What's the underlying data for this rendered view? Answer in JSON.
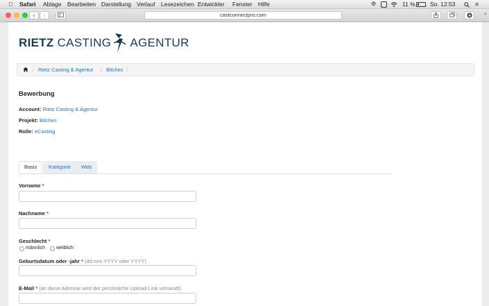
{
  "menubar": {
    "app_name": "Safari",
    "items": [
      "Ablage",
      "Bearbeiten",
      "Darstellung",
      "Verlauf",
      "Lesezeichen",
      "Entwickler",
      "Fenster",
      "Hilfe"
    ],
    "battery": "11 %",
    "clock": "So. 12:53"
  },
  "browser": {
    "url": "castconnectpro.com"
  },
  "logo": {
    "part1": "RIETZ",
    "part2": "CASTING",
    "part3": "AGENTUR"
  },
  "breadcrumb": {
    "items": [
      "Rietz Casting & Agentur",
      "Bitches"
    ]
  },
  "application": {
    "title": "Bewerbung",
    "account_label": "Account:",
    "account_value": "Rietz Casting & Agentur",
    "project_label": "Projekt:",
    "project_value": "Bitches",
    "role_label": "Rolle:",
    "role_value": "eCasting"
  },
  "tabs": [
    "Basis",
    "Kategorie",
    "Web"
  ],
  "form": {
    "firstname_label": "Vorname",
    "lastname_label": "Nachname",
    "gender_label": "Geschlecht",
    "gender_options": [
      "männlich",
      "weiblich"
    ],
    "birth_label": "Geburtsdatum oder -jahr",
    "birth_hint": "(dd.mm.YYYY oder YYYY)",
    "email_label": "E-Mail",
    "email_hint": "(an diese Adresse wird der persönliche Upload-Link versandt)",
    "required_mark": "*"
  }
}
